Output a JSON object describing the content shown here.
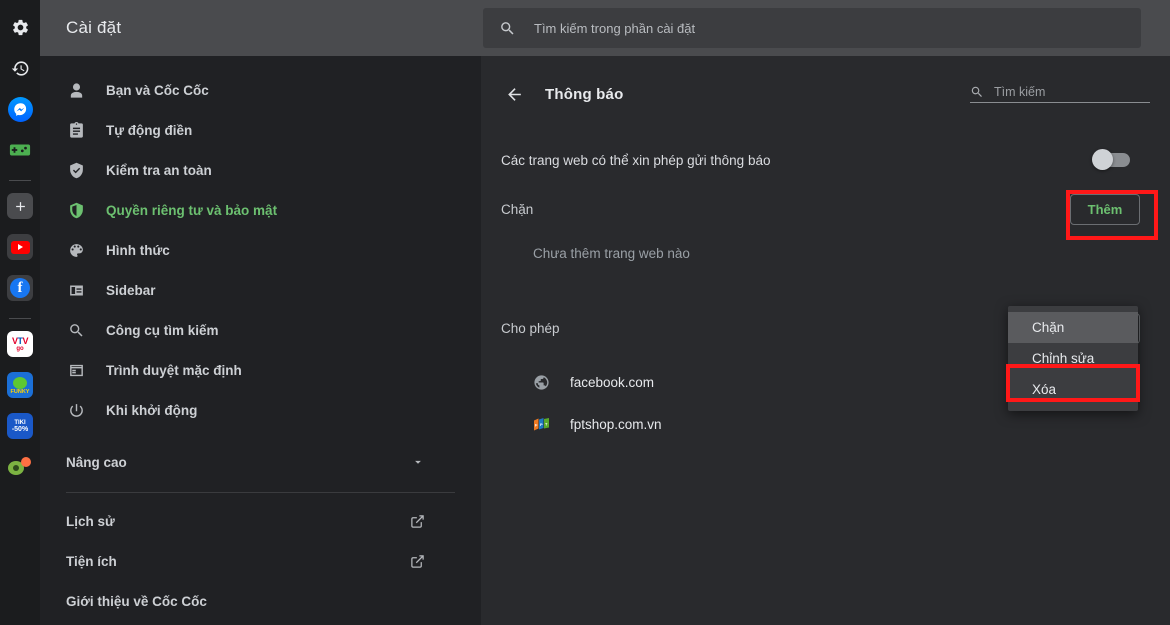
{
  "rail": {
    "items": [
      {
        "name": "settings-gear",
        "label": "Cài đặt"
      },
      {
        "name": "history-clock",
        "label": "Lịch sử"
      },
      {
        "name": "messenger",
        "label": "Messenger"
      },
      {
        "name": "game-controller",
        "label": "Trò chơi"
      },
      {
        "name": "add-plus",
        "label": "Thêm"
      },
      {
        "name": "youtube",
        "label": "YouTube"
      },
      {
        "name": "facebook",
        "label": "Facebook"
      },
      {
        "name": "vtvgo",
        "label": "VTV go"
      },
      {
        "name": "funky",
        "label": "Funky"
      },
      {
        "name": "tiki",
        "label": "TIKI -50%"
      },
      {
        "name": "coccoc",
        "label": "Cốc Cốc"
      }
    ]
  },
  "sidebar": {
    "title": "Cài đặt",
    "items": [
      {
        "label": "Bạn và Cốc Cốc",
        "icon": "person-icon",
        "active": false
      },
      {
        "label": "Tự động điền",
        "icon": "clipboard-icon",
        "active": false
      },
      {
        "label": "Kiểm tra an toàn",
        "icon": "shield-check-icon",
        "active": false
      },
      {
        "label": "Quyền riêng tư và bảo mật",
        "icon": "shield-icon",
        "active": true
      },
      {
        "label": "Hình thức",
        "icon": "palette-icon",
        "active": false
      },
      {
        "label": "Sidebar",
        "icon": "sidebar-icon",
        "active": false
      },
      {
        "label": "Công cụ tìm kiếm",
        "icon": "search-icon",
        "active": false
      },
      {
        "label": "Trình duyệt mặc định",
        "icon": "browser-icon",
        "active": false
      },
      {
        "label": "Khi khởi động",
        "icon": "power-icon",
        "active": false
      }
    ],
    "advanced_label": "Nâng cao",
    "footer_items": [
      {
        "label": "Lịch sử",
        "external": true
      },
      {
        "label": "Tiện ích",
        "external": true
      },
      {
        "label": "Giới thiệu về Cốc Cốc",
        "external": false
      }
    ]
  },
  "search": {
    "placeholder": "Tìm kiếm trong phần cài đặt",
    "value": ""
  },
  "panel": {
    "title": "Thông báo",
    "mini_search_placeholder": "Tìm kiếm",
    "mini_search_value": "",
    "toggle_row": {
      "label": "Các trang web có thể xin phép gửi thông báo",
      "state": "off"
    },
    "blocked": {
      "label": "Chặn",
      "add_label": "Thêm",
      "empty_text": "Chưa thêm trang web nào",
      "sites": []
    },
    "allowed": {
      "label": "Cho phép",
      "add_label": "Thêm",
      "sites": [
        {
          "name": "facebook.com",
          "favicon": "globe-icon"
        },
        {
          "name": "fptshop.com.vn",
          "favicon": "fpt-logo-icon"
        }
      ]
    }
  },
  "context_menu": {
    "items": [
      {
        "label": "Chặn",
        "highlighted": true
      },
      {
        "label": "Chỉnh sửa",
        "highlighted": false
      },
      {
        "label": "Xóa",
        "highlighted": false
      }
    ]
  },
  "colors": {
    "accent_green": "#6cc070",
    "highlight_red": "#ff1818",
    "sidebar_bg": "#202124",
    "main_bg": "#292a2d",
    "topbar_bg": "#4a4b4e"
  }
}
